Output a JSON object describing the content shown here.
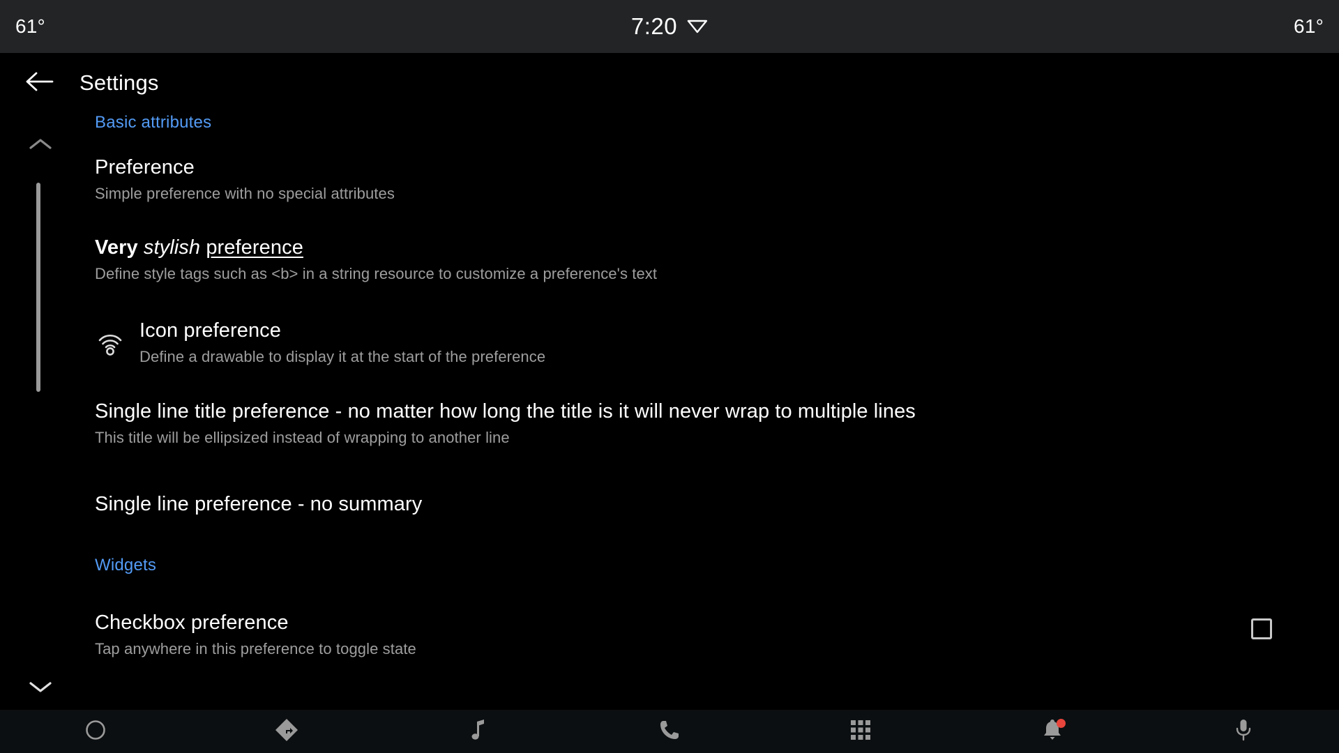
{
  "status_bar": {
    "left_temp": "61°",
    "right_temp": "61°",
    "clock": "7:20",
    "wifi_icon": "wifi-icon"
  },
  "app_bar": {
    "back_icon": "back-arrow-icon",
    "title": "Settings"
  },
  "colors": {
    "accent_blue": "#539bf5",
    "background": "#000000",
    "status_bar_bg": "#222426",
    "nav_bar_bg": "#0c0f11",
    "title_text": "#ffffff",
    "summary_text": "#9e9e9e",
    "badge_red": "#e8453c",
    "scrollbar": "#9a9a9a"
  },
  "content": {
    "collapse_up_icon": "chevron-up-icon",
    "expand_down_icon": "chevron-down-icon",
    "sections": [
      {
        "header": "Basic attributes",
        "preferences": [
          {
            "title": "Preference",
            "summary": "Simple preference with no special attributes"
          },
          {
            "title_parts": {
              "bold": "Very",
              "italic": "stylish",
              "underline": "preference"
            },
            "summary": "Define style tags such as <b> in a string resource to customize a preference's text"
          },
          {
            "icon": "wifi-tethering-icon",
            "title": "Icon preference",
            "summary": "Define a drawable to display it at the start of the preference"
          },
          {
            "title": "Single line title preference - no matter how long the title is it will never wrap to multiple lines",
            "summary": "This title will be ellipsized instead of wrapping to another line"
          },
          {
            "title": "Single line preference - no summary",
            "summary": ""
          }
        ]
      },
      {
        "header": "Widgets",
        "preferences": [
          {
            "title": "Checkbox preference",
            "summary": "Tap anywhere in this preference to toggle state",
            "widget": "checkbox",
            "checked": false
          }
        ]
      }
    ]
  },
  "bottom_nav": {
    "items": [
      {
        "icon": "home-circle-icon",
        "label": "Home"
      },
      {
        "icon": "navigation-directions-icon",
        "label": "Navigation"
      },
      {
        "icon": "music-note-icon",
        "label": "Media"
      },
      {
        "icon": "phone-icon",
        "label": "Phone"
      },
      {
        "icon": "apps-grid-icon",
        "label": "Apps"
      },
      {
        "icon": "notification-bell-icon",
        "label": "Notifications",
        "badge": true
      },
      {
        "icon": "microphone-icon",
        "label": "Assistant"
      }
    ]
  }
}
